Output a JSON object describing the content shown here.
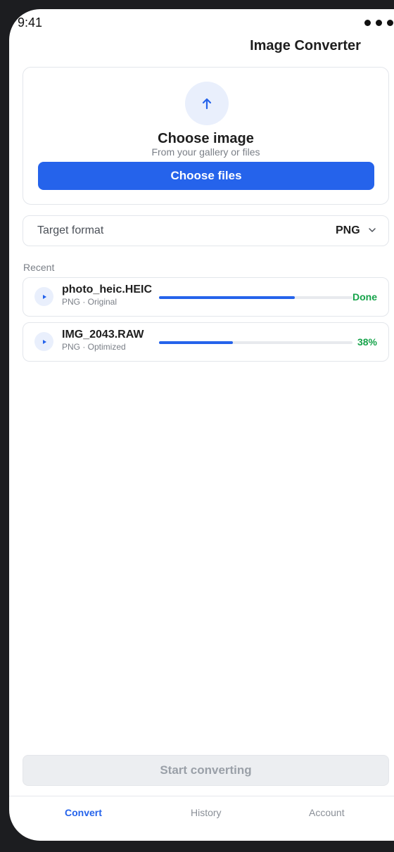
{
  "status_bar": {
    "time": "9:41"
  },
  "app": {
    "title": "Image Converter"
  },
  "upload": {
    "heading": "Choose image",
    "subtext": "From your gallery or files",
    "button_label": "Choose files"
  },
  "format": {
    "label": "Target format",
    "value": "PNG"
  },
  "recent": {
    "label": "Recent",
    "jobs": [
      {
        "name": "photo_heic.HEIC",
        "meta": "PNG · Original",
        "progress": 0.7,
        "status": "Done"
      },
      {
        "name": "IMG_2043.RAW",
        "meta": "PNG · Optimized",
        "progress": 0.38,
        "status": "38%"
      }
    ]
  },
  "actions": {
    "start_label": "Start converting"
  },
  "tabs": [
    {
      "label": "Convert",
      "active": true
    },
    {
      "label": "History",
      "active": false
    },
    {
      "label": "Account",
      "active": false
    }
  ],
  "colors": {
    "accent": "#2563eb",
    "success": "#16a34a",
    "disabled": "#eceef1"
  }
}
